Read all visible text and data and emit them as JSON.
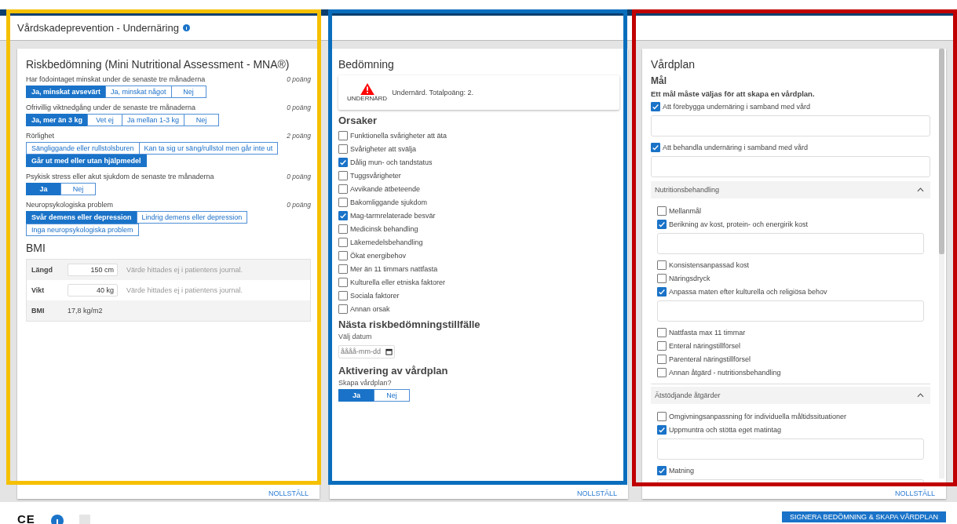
{
  "header": {
    "title": "Vårdskadeprevention - Undernäring"
  },
  "risk": {
    "title": "Riskbedömning (Mini Nutritional Assessment - MNA®)",
    "questions": [
      {
        "label": "Har födointaget minskat under de senaste tre månaderna",
        "points": "0 poäng",
        "options": [
          {
            "label": "Ja, minskat avsevärt",
            "selected": true
          },
          {
            "label": "Ja, minskat något",
            "selected": false
          },
          {
            "label": "Nej",
            "selected": false
          }
        ]
      },
      {
        "label": "Ofrivillig viktnedgång under de senaste tre månaderna",
        "points": "0 poäng",
        "options": [
          {
            "label": "Ja, mer än 3 kg",
            "selected": true
          },
          {
            "label": "Vet ej",
            "selected": false
          },
          {
            "label": "Ja mellan 1-3 kg",
            "selected": false
          },
          {
            "label": "Nej",
            "selected": false
          }
        ]
      },
      {
        "label": "Rörlighet",
        "points": "2 poäng",
        "options": [
          {
            "label": "Sängliggande eller rullstolsburen",
            "selected": false
          },
          {
            "label": "Kan ta sig ur säng/rullstol men går inte ut",
            "selected": false
          },
          {
            "label": "Går ut med eller utan hjälpmedel",
            "selected": true
          }
        ]
      },
      {
        "label": "Psykisk stress eller akut sjukdom de senaste tre månaderna",
        "points": "0 poäng",
        "options": [
          {
            "label": "Ja",
            "selected": true
          },
          {
            "label": "Nej",
            "selected": false
          }
        ]
      },
      {
        "label": "Neuropsykologiska problem",
        "points": "0 poäng",
        "options": [
          {
            "label": "Svår demens eller depression",
            "selected": true
          },
          {
            "label": "Lindrig demens eller depression",
            "selected": false
          },
          {
            "label": "Inga neuropsykologiska problem",
            "selected": false
          }
        ]
      }
    ],
    "bmi": {
      "title": "BMI",
      "rows": [
        {
          "kind": "input",
          "label": "Längd",
          "value": "150 cm",
          "note": "Värde hittades ej i patientens journal."
        },
        {
          "kind": "input",
          "label": "Vikt",
          "value": "40 kg",
          "note": "Värde hittades ej i patientens journal."
        },
        {
          "kind": "text",
          "label": "BMI",
          "value": "17,8 kg/m2"
        }
      ]
    },
    "reset": "NOLLSTÄLL"
  },
  "assessment": {
    "title": "Bedömning",
    "badge": "UNDERNÄRD",
    "result": "Undernärd. Totalpoäng: 2.",
    "causes": {
      "title": "Orsaker",
      "items": [
        {
          "label": "Funktionella svårigheter att äta",
          "checked": false
        },
        {
          "label": "Svårigheter att svälja",
          "checked": false
        },
        {
          "label": "Dålig mun- och tandstatus",
          "checked": true
        },
        {
          "label": "Tuggsvårigheter",
          "checked": false
        },
        {
          "label": "Avvikande ätbeteende",
          "checked": false
        },
        {
          "label": "Bakomliggande sjukdom",
          "checked": false
        },
        {
          "label": "Mag-tarmrelaterade besvär",
          "checked": true
        },
        {
          "label": "Medicinsk behandling",
          "checked": false
        },
        {
          "label": "Läkemedelsbehandling",
          "checked": false
        },
        {
          "label": "Ökat energibehov",
          "checked": false
        },
        {
          "label": "Mer än 11 timmars nattfasta",
          "checked": false
        },
        {
          "label": "Kulturella eller etniska faktorer",
          "checked": false
        },
        {
          "label": "Sociala faktorer",
          "checked": false
        },
        {
          "label": "Annan orsak",
          "checked": false
        }
      ]
    },
    "next": {
      "title": "Nästa riskbedömningstillfälle",
      "label": "Välj datum",
      "placeholder": "åååå-mm-dd"
    },
    "activation": {
      "title": "Aktivering av vårdplan",
      "label": "Skapa vårdplan?",
      "options": [
        {
          "label": "Ja",
          "selected": true
        },
        {
          "label": "Nej",
          "selected": false
        }
      ]
    },
    "reset": "NOLLSTÄLL"
  },
  "careplan": {
    "title": "Vårdplan",
    "subtitle": "Mål",
    "note": "Ett mål måste väljas för att skapa en vårdplan.",
    "goals": [
      {
        "label": "Att förebygga undernäring i samband med vård",
        "checked": true
      },
      {
        "label": "Att behandla undernäring i samband med vård",
        "checked": true
      }
    ],
    "sections": [
      {
        "title": "Nutritionsbehandling",
        "expanded": true,
        "items": [
          {
            "label": "Mellanmål",
            "checked": false
          },
          {
            "label": "Berikning av kost, protein- och energirik kost",
            "checked": true
          },
          {
            "label": "Konsistensanpassad kost",
            "checked": false
          },
          {
            "label": "Näringsdryck",
            "checked": false
          },
          {
            "label": "Anpassa maten efter kulturella och religiösa behov",
            "checked": true
          },
          {
            "label": "Nattfasta max 11 timmar",
            "checked": false
          },
          {
            "label": "Enteral näringstillförsel",
            "checked": false
          },
          {
            "label": "Parenteral näringstillförsel",
            "checked": false
          },
          {
            "label": "Annan åtgärd - nutritionsbehandling",
            "checked": false
          }
        ]
      },
      {
        "title": "Ätstödjande åtgärder",
        "expanded": true,
        "items": [
          {
            "label": "Omgivningsanpassning för individuella måltidssituationer",
            "checked": false
          },
          {
            "label": "Uppmuntra och stötta eget matintag",
            "checked": true
          },
          {
            "label": "Matning",
            "checked": true
          }
        ]
      }
    ],
    "reset": "NOLLSTÄLL"
  },
  "footer": {
    "mark": "CE",
    "button": "SIGNERA BEDÖMNING & SKAPA VÅRDPLAN"
  },
  "frames": [
    {
      "color": "#f5c000"
    },
    {
      "color": "#0a6ebd"
    },
    {
      "color": "#c00000"
    }
  ]
}
